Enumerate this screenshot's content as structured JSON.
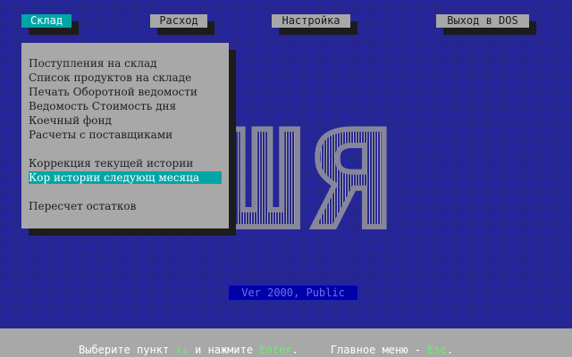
{
  "menu": {
    "tabs": [
      {
        "label": "Склад"
      },
      {
        "label": "Расход"
      },
      {
        "label": "Настройка"
      },
      {
        "label": "Выход в DOS"
      }
    ],
    "active_tab": "Склад",
    "dropdown": {
      "items": [
        "Поступления на склад",
        "Список продуктов на складе",
        "Печать Оборотной ведомости",
        "Ведомость  Стоимость дня",
        "Коечный фонд",
        "Расчеты с поставщиками",
        "",
        "Коррекция текущей истории",
        "Кор истории следующ месяца",
        "",
        "Пересчет остатков"
      ],
      "selected_index": 8
    }
  },
  "background_logo": "АШЯ",
  "version": "Ver 2000, Public",
  "status": {
    "part1": "Выберите пункт ",
    "arrows": "↑↓",
    "part2": " и нажмите ",
    "enter": "Enter",
    "part3": ".     Главное меню - ",
    "esc": "Esc",
    "part4": "."
  },
  "colors": {
    "background": "#2a2aa6",
    "menu_gray": "#a8a8a8",
    "highlight": "#00a6a6",
    "hint_green": "#55ff55"
  }
}
